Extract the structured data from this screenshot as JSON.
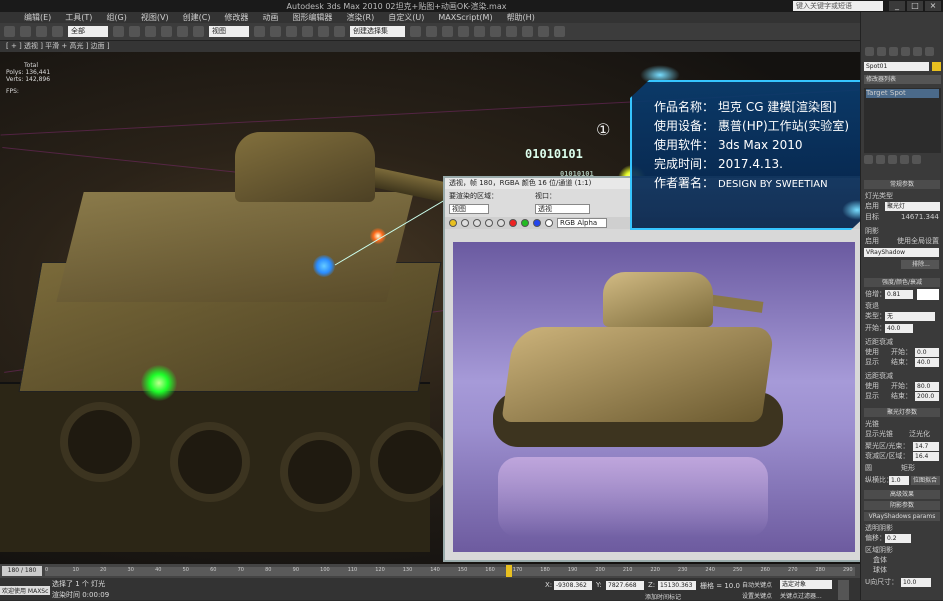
{
  "titlebar": {
    "title": "Autodesk 3ds Max 2010     02坦克+贴图+动画OK-渲染.max",
    "search_placeholder": "键入关键字或短语",
    "window_buttons": [
      "_",
      "□",
      "×"
    ]
  },
  "menu": {
    "items": [
      "编辑(E)",
      "工具(T)",
      "组(G)",
      "视图(V)",
      "创建(C)",
      "修改器",
      "动画",
      "图形编辑器",
      "渲染(R)",
      "自定义(U)",
      "MAXScript(M)",
      "帮助(H)"
    ]
  },
  "toolbar": {
    "selection_filter": "全部",
    "reference_coord": "视图",
    "selection_set": "创建选择集"
  },
  "viewport": {
    "label": "[ + ] 透视 ] 平滑 + 高光 ] 边面 ]",
    "stats": {
      "total_label": "Total",
      "polys_label": "Polys:",
      "polys_value": "136,441",
      "verts_label": "Verts:",
      "verts_value": "142,896",
      "fps_label": "FPS:"
    },
    "binary_text_1": "01010101",
    "binary_text_2": "01010101",
    "circle_mark": "①"
  },
  "render_window": {
    "title": "透视，帧 180，RGBA 颜色 16 位/通道 (1:1)",
    "area_label": "要渲染的区域：",
    "area_value": "视图",
    "viewport_label": "视口：",
    "viewport_value": "透视",
    "channel_value": "RGB Alpha"
  },
  "info_panel": {
    "lines": [
      {
        "label": "作品名称：",
        "value": "坦克 CG 建模[渲染图]"
      },
      {
        "label": "使用设备：",
        "value": "惠普(HP)工作站(实验室)"
      },
      {
        "label": "使用软件：",
        "value": "3ds Max 2010"
      },
      {
        "label": "完成时间：",
        "value": "2017.4.13."
      },
      {
        "label": "作者署名：",
        "value": "DESIGN BY SWEETIAN"
      }
    ]
  },
  "command_panel": {
    "object_name": "Spot01",
    "modifier_list": "修改器列表",
    "stack_item": "Target Spot",
    "general_params": "常规参数",
    "light_type": "灯光类型",
    "light_type_checkbox": "启用",
    "spot_type": "聚光灯",
    "targeted": "目标",
    "target_distance": "14671.344",
    "shadows": "阴影",
    "shadows_on": "启用",
    "use_global": "使用全局设置",
    "shadow_type": "VRayShadow",
    "exclude": "排除...",
    "intensity_header": "强度/颜色/衰减",
    "multiplier_label": "倍增：",
    "multiplier_value": "0.81",
    "decay": "衰退",
    "decay_type_label": "类型：",
    "decay_type": "无",
    "decay_start_label": "开始：",
    "decay_start": "40.0",
    "near_atten": "近距衰减",
    "near_use": "使用",
    "near_start_label": "开始：",
    "near_start": "0.0",
    "near_show": "显示",
    "near_end_label": "结束：",
    "near_end": "40.0",
    "far_atten": "远距衰减",
    "far_use": "使用",
    "far_start_label": "开始：",
    "far_start": "80.0",
    "far_show": "显示",
    "far_end_label": "结束：",
    "far_end": "200.0",
    "spot_params": "聚光灯参数",
    "light_cone": "光锥",
    "show_cone": "显示光锥",
    "overshoot": "泛光化",
    "hotspot_label": "聚光区/光束：",
    "hotspot_value": "14.7",
    "falloff_label": "衰减区/区域：",
    "falloff_value": "16.4",
    "circle": "圆",
    "rectangle": "矩形",
    "aspect_label": "纵横比：",
    "aspect_value": "1.0",
    "bitmap_fit": "位图拟合",
    "advanced_effects": "高级效果",
    "shadow_params": "阴影参数",
    "vray_shadow_params": "VRayShadows params",
    "transparent_shadows": "透明阴影",
    "bias_label": "偏移：",
    "bias_value": "0.2",
    "area_shadow": "区域阴影",
    "box": "盒体",
    "sphere": "球体",
    "u_size_label": "U向尺寸：",
    "u_size_value": "10.0"
  },
  "timeline": {
    "frame_indicator": "180 / 180",
    "ticks": [
      "0",
      "10",
      "20",
      "30",
      "40",
      "50",
      "60",
      "70",
      "80",
      "90",
      "100",
      "110",
      "120",
      "130",
      "140",
      "150",
      "160",
      "170",
      "180",
      "190",
      "200",
      "210",
      "220",
      "230",
      "240",
      "250",
      "260",
      "270",
      "280",
      "290"
    ]
  },
  "status": {
    "welcome": "欢迎使用 MAXSc",
    "selection": "选择了 1 个 灯光",
    "prompt": "渲染时间 0:00:09",
    "x_label": "X:",
    "x_value": "-9308.362",
    "y_label": "Y:",
    "y_value": "7827.668",
    "z_label": "Z:",
    "z_value": "15130.363",
    "grid": "栅格 = 10.0",
    "add_time_tag": "添加时间标记",
    "auto_key": "自动关键点",
    "selected_object": "选定对象",
    "set_key": "设置关键点",
    "key_filters": "关键点过滤器..."
  }
}
